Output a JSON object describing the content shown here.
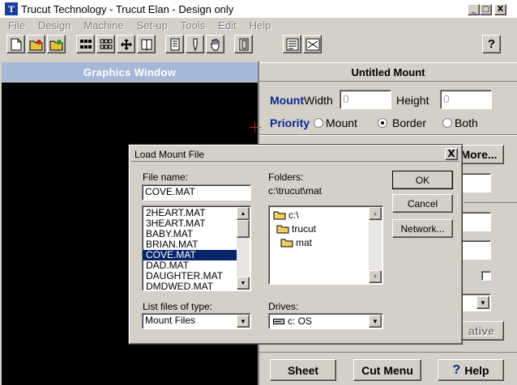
{
  "window": {
    "title": "Trucut Technology - Trucut Elan - Design only",
    "icon_letter": "T"
  },
  "window_controls": {
    "minimize": "_",
    "maximize": "□",
    "close": "X"
  },
  "menu": [
    "File",
    "Design",
    "Machine",
    "Set-up",
    "Tools",
    "Edit",
    "Help"
  ],
  "toolbar": {
    "help_glyph": "?"
  },
  "graphics": {
    "title": "Graphics Window"
  },
  "mount": {
    "title": "Untitled Mount",
    "mount_label": "Mount",
    "width_label": "Width",
    "width_value": "0",
    "height_label": "Height",
    "height_value": "0",
    "priority_label": "Priority",
    "radio_mount": "Mount",
    "radio_border": "Border",
    "radio_both": "Both",
    "more_button": "More...",
    "negative_button": "ative",
    "sheet_button": "Sheet",
    "cutmenu_button": "Cut Menu",
    "help_button": "Help",
    "help_icon": "?"
  },
  "dialog": {
    "title": "Load Mount File",
    "close": "X",
    "filename_label": "File name:",
    "filename_value": "COVE.MAT",
    "files": [
      "2HEART.MAT",
      "3HEART.MAT",
      "BABY.MAT",
      "BRIAN.MAT",
      "COVE.MAT",
      "DAD.MAT",
      "DAUGHTER.MAT",
      "DMDWED.MAT"
    ],
    "selected_file": "COVE.MAT",
    "folders_label": "Folders:",
    "folders_path": "c:\\trucut\\mat",
    "folders": [
      "c:\\",
      "trucut",
      "mat"
    ],
    "filetype_label": "List files of type:",
    "filetype_value": "Mount Files",
    "drives_label": "Drives:",
    "drives_value": "c: OS",
    "ok_button": "OK",
    "cancel_button": "Cancel",
    "network_button": "Network..."
  }
}
